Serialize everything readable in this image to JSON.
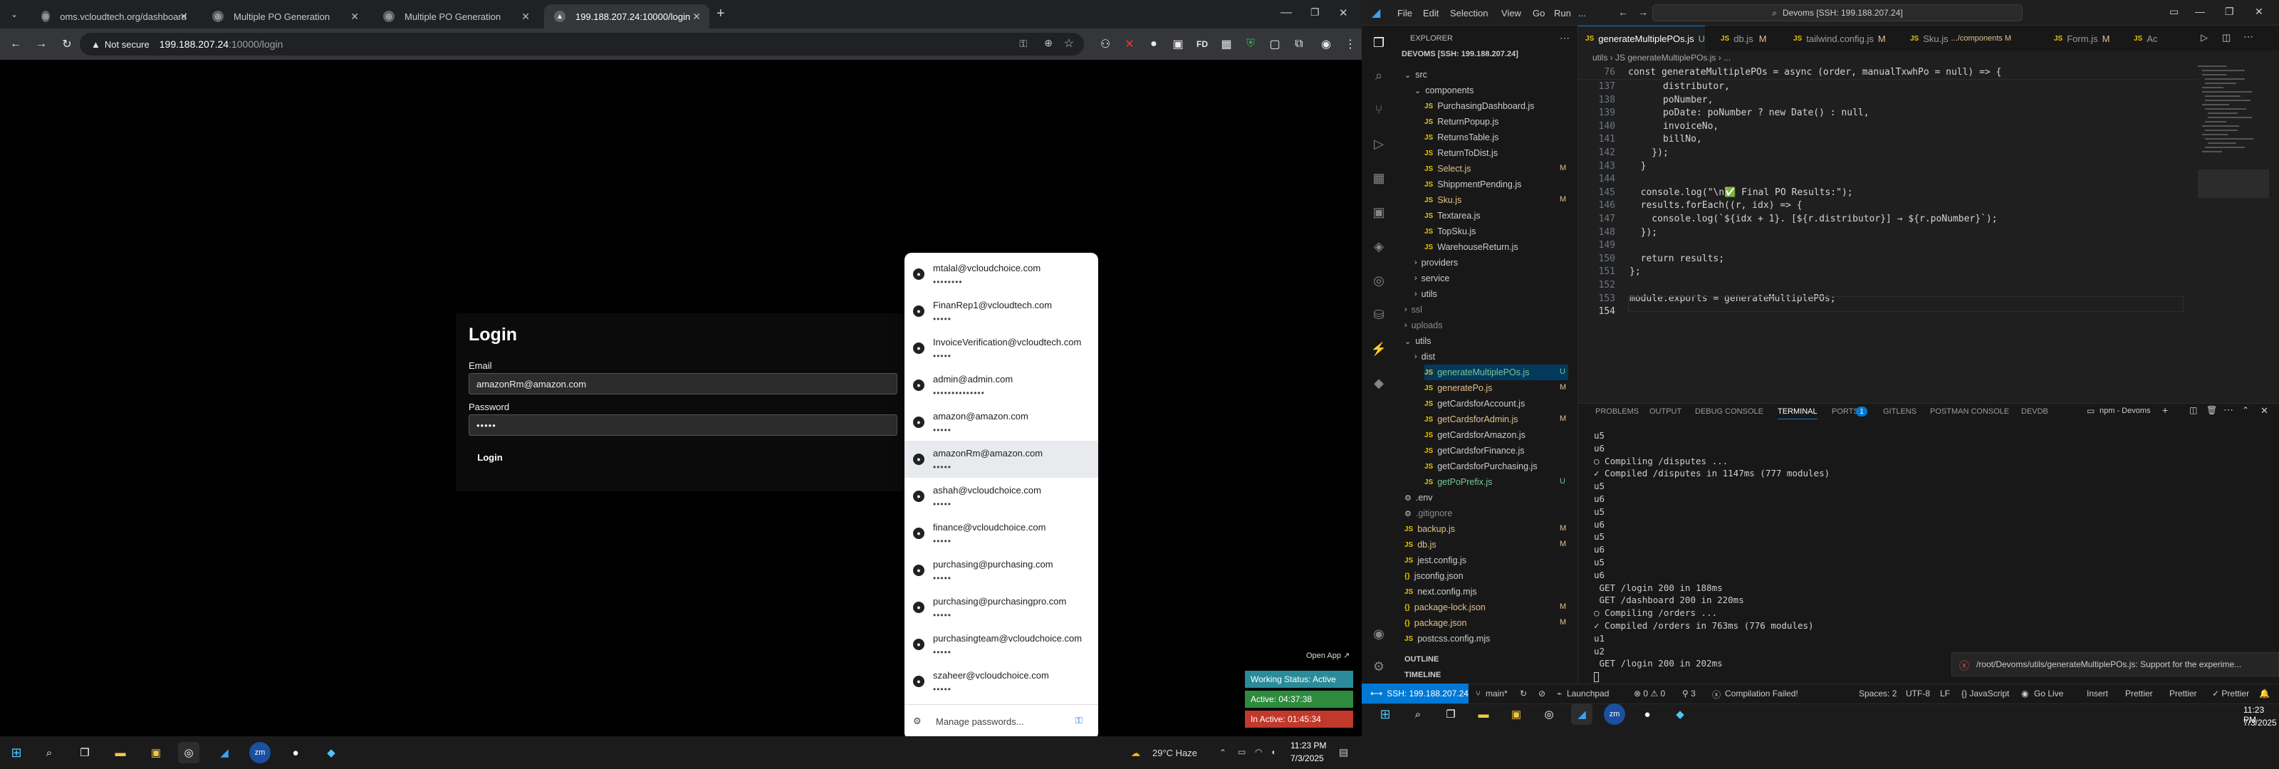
{
  "chrome": {
    "tabs": [
      {
        "title": "oms.vcloudtech.org/dashboard"
      },
      {
        "title": "Multiple PO Generation"
      },
      {
        "title": "Multiple PO Generation"
      },
      {
        "title": "199.188.207.24:10000/login"
      }
    ],
    "new_tab": "+",
    "omnibox": {
      "security": "Not secure",
      "host": "199.188.207.24",
      "path": ":10000/login"
    }
  },
  "login": {
    "title": "Login",
    "email_label": "Email",
    "email_value": "amazonRm@amazon.com",
    "password_label": "Password",
    "password_value": "•••••",
    "submit": "Login"
  },
  "password_popup": {
    "entries": [
      {
        "user": "mtalal@vcloudchoice.com",
        "pass": "••••••••"
      },
      {
        "user": "FinanRep1@vcloudtech.com",
        "pass": "•••••"
      },
      {
        "user": "InvoiceVerification@vcloudtech.com",
        "pass": "•••••"
      },
      {
        "user": "admin@admin.com",
        "pass": "••••••••••••••"
      },
      {
        "user": "amazon@amazon.com",
        "pass": "•••••"
      },
      {
        "user": "amazonRm@amazon.com",
        "pass": "•••••"
      },
      {
        "user": "ashah@vcloudchoice.com",
        "pass": "•••••"
      },
      {
        "user": "finance@vcloudchoice.com",
        "pass": "•••••"
      },
      {
        "user": "purchasing@purchasing.com",
        "pass": "•••••"
      },
      {
        "user": "purchasing@purchasingpro.com",
        "pass": "•••••"
      },
      {
        "user": "purchasingteam@vcloudchoice.com",
        "pass": "•••••"
      },
      {
        "user": "szaheer@vcloudchoice.com",
        "pass": "•••••"
      }
    ],
    "manage": "Manage passwords..."
  },
  "work_tracker": {
    "open_app": "Open App ↗",
    "status": "Working Status: Active",
    "active": "Active: 04:37:38",
    "inactive": "In Active: 01:45:34",
    "colors": {
      "status": "#2a8c9a",
      "active": "#2e8b3e",
      "inactive": "#c0392b"
    }
  },
  "taskbar_left": {
    "weather": "29°C  Haze",
    "time": "11:23 PM",
    "date": "7/3/2025"
  },
  "vscode": {
    "menu": [
      "File",
      "Edit",
      "Selection",
      "View",
      "Go",
      "Run",
      "..."
    ],
    "command_center": "Devoms [SSH: 199.188.207.24]",
    "explorer_title": "EXPLORER",
    "root": "DEVOMS [SSH: 199.188.207.24]",
    "tree": [
      {
        "name": "src",
        "kind": "folder",
        "open": true
      },
      {
        "name": "components",
        "kind": "folder",
        "open": true
      },
      {
        "name": "PurchasingDashboard.js",
        "kind": "js"
      },
      {
        "name": "ReturnPopup.js",
        "kind": "js"
      },
      {
        "name": "ReturnsTable.js",
        "kind": "js"
      },
      {
        "name": "ReturnToDist.js",
        "kind": "js"
      },
      {
        "name": "Select.js",
        "kind": "js",
        "badge": "M"
      },
      {
        "name": "ShippmentPending.js",
        "kind": "js"
      },
      {
        "name": "Sku.js",
        "kind": "js",
        "badge": "M"
      },
      {
        "name": "Textarea.js",
        "kind": "js"
      },
      {
        "name": "TopSku.js",
        "kind": "js"
      },
      {
        "name": "WarehouseReturn.js",
        "kind": "js"
      },
      {
        "name": "providers",
        "kind": "folder"
      },
      {
        "name": "service",
        "kind": "folder"
      },
      {
        "name": "utils",
        "kind": "folder"
      },
      {
        "name": "ssl",
        "kind": "folder"
      },
      {
        "name": "uploads",
        "kind": "folder"
      },
      {
        "name": "utils",
        "kind": "folder",
        "open": true
      },
      {
        "name": "dist",
        "kind": "folder"
      },
      {
        "name": "generateMultiplePOs.js",
        "kind": "js",
        "badge": "U",
        "selected": true
      },
      {
        "name": "generatePo.js",
        "kind": "js",
        "badge": "M"
      },
      {
        "name": "getCardsforAccount.js",
        "kind": "js"
      },
      {
        "name": "getCardsforAdmin.js",
        "kind": "js",
        "badge": "M"
      },
      {
        "name": "getCardsforAmazon.js",
        "kind": "js"
      },
      {
        "name": "getCardsforFinance.js",
        "kind": "js"
      },
      {
        "name": "getCardsforPurchasing.js",
        "kind": "js"
      },
      {
        "name": "getPoPrefix.js",
        "kind": "js",
        "badge": "U"
      },
      {
        "name": ".env",
        "kind": "file"
      },
      {
        "name": ".gitignore",
        "kind": "file"
      },
      {
        "name": "backup.js",
        "kind": "js",
        "badge": "M"
      },
      {
        "name": "db.js",
        "kind": "js",
        "badge": "M"
      },
      {
        "name": "jest.config.js",
        "kind": "js"
      },
      {
        "name": "jsconfig.json",
        "kind": "json"
      },
      {
        "name": "next.config.mjs",
        "kind": "js"
      },
      {
        "name": "package-lock.json",
        "kind": "json",
        "badge": "M"
      },
      {
        "name": "package.json",
        "kind": "json",
        "badge": "M"
      },
      {
        "name": "postcss.config.mjs",
        "kind": "js"
      }
    ],
    "outline": "OUTLINE",
    "timeline": "TIMELINE",
    "editor_tabs": [
      {
        "name": "generateMultiplePOs.js",
        "badge": "U"
      },
      {
        "name": "db.js",
        "badge": "M"
      },
      {
        "name": "tailwind.config.js",
        "badge": "M"
      },
      {
        "name": "Sku.js",
        "badge": ".../components M"
      },
      {
        "name": "Form.js",
        "badge": "M"
      },
      {
        "name": "Ac",
        "badge": ""
      }
    ],
    "breadcrumb": "utils › JS generateMultiplePOs.js › ...",
    "sticky": {
      "no": "76",
      "code": "const generateMultiplePOs = async (order, manualTxwhPo = null) => {"
    },
    "code": [
      {
        "no": "137",
        "code": "      distributor,"
      },
      {
        "no": "138",
        "code": "      poNumber,"
      },
      {
        "no": "139",
        "code": "      poDate: poNumber ? new Date() : null,"
      },
      {
        "no": "140",
        "code": "      invoiceNo,"
      },
      {
        "no": "141",
        "code": "      billNo,"
      },
      {
        "no": "142",
        "code": "    });"
      },
      {
        "no": "143",
        "code": "  }"
      },
      {
        "no": "144",
        "code": ""
      },
      {
        "no": "145",
        "code": "  console.log(\"\\n✅ Final PO Results:\");"
      },
      {
        "no": "146",
        "code": "  results.forEach((r, idx) => {"
      },
      {
        "no": "147",
        "code": "    console.log(`${idx + 1}. [${r.distributor}] → ${r.poNumber}`);"
      },
      {
        "no": "148",
        "code": "  });"
      },
      {
        "no": "149",
        "code": ""
      },
      {
        "no": "150",
        "code": "  return results;"
      },
      {
        "no": "151",
        "code": "};"
      },
      {
        "no": "152",
        "code": ""
      },
      {
        "no": "153",
        "code": "module.exports = generateMultiplePOs;"
      },
      {
        "no": "154",
        "code": ""
      }
    ],
    "panel_tabs": [
      "PROBLEMS",
      "OUTPUT",
      "DEBUG CONSOLE",
      "TERMINAL",
      "PORTS",
      "GITLENS",
      "POSTMAN CONSOLE",
      "DEVDB"
    ],
    "ports_count": "1",
    "terminal_name": "npm - Devoms",
    "terminal": [
      "u5",
      "u6",
      "○ Compiling /disputes ...",
      "✓ Compiled /disputes in 1147ms (777 modules)",
      "u5",
      "u6",
      "u5",
      "u6",
      "u5",
      "u6",
      "u5",
      "u6",
      " GET /login 200 in 188ms",
      " GET /dashboard 200 in 220ms",
      "○ Compiling /orders ...",
      "✓ Compiled /orders in 763ms (776 modules)",
      "u1",
      "u2",
      " GET /login 200 in 202ms"
    ],
    "toast": "/root/Devoms/utils/generateMultiplePOs.js: Support for the experime...",
    "status": {
      "remote": "SSH: 199.188.207.24",
      "branch": "main*",
      "launchpad": "Launchpad",
      "problems": "⊗ 0 ⚠ 0",
      "ports": "⚲ 3",
      "compile": "Compilation Failed!",
      "spaces": "Spaces: 2",
      "encoding": "UTF-8",
      "eol": "LF",
      "lang": "{} JavaScript",
      "golive": "Go Live",
      "insert": "Insert",
      "prettier1": "Prettier",
      "prettier2": "Prettier",
      "prettier3": "✓ Prettier"
    },
    "time": "11:23 PM",
    "date": "7/3/2025"
  }
}
